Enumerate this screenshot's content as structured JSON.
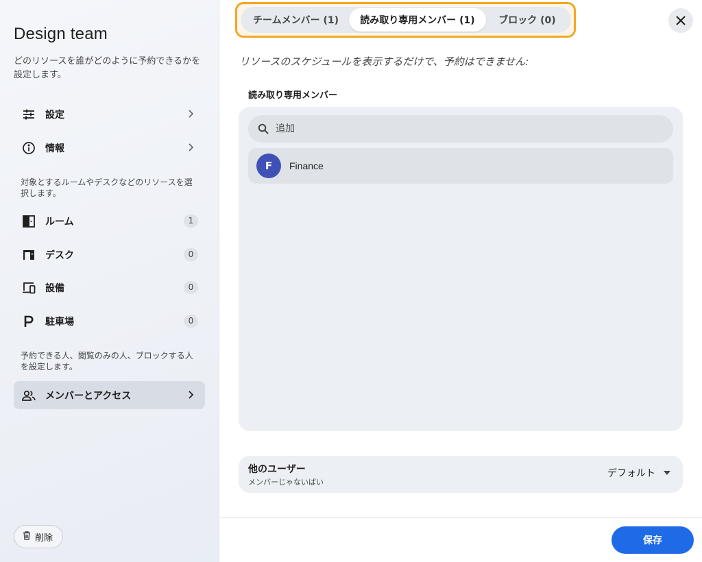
{
  "sidebar": {
    "title": "Design team",
    "description": "どのリソースを誰がどのように予約できるかを設定します。",
    "items_top": [
      {
        "id": "settings",
        "label": "設定",
        "icon": "tune-icon"
      },
      {
        "id": "info",
        "label": "情報",
        "icon": "info-icon"
      }
    ],
    "resources_note": "対象とするルームやデスクなどのリソースを選択します。",
    "resources": [
      {
        "id": "rooms",
        "label": "ルーム",
        "count": "1",
        "icon": "door-icon"
      },
      {
        "id": "desks",
        "label": "デスク",
        "count": "0",
        "icon": "desk-icon"
      },
      {
        "id": "equipment",
        "label": "設備",
        "count": "0",
        "icon": "devices-icon"
      },
      {
        "id": "parking",
        "label": "駐車場",
        "count": "0",
        "icon": "parking-icon"
      }
    ],
    "access_note": "予約できる人、閲覧のみの人、ブロックする人を設定します。",
    "access_item": {
      "label": "メンバーとアクセス",
      "icon": "people-icon"
    },
    "delete_label": "削除"
  },
  "tabs": [
    {
      "label": "チームメンバー (1)",
      "active": false
    },
    {
      "label": "読み取り専用メンバー (1)",
      "active": true
    },
    {
      "label": "ブロック (0)",
      "active": false
    }
  ],
  "main": {
    "subtitle": "リソースのスケジュールを表示するだけで、予約はできません:",
    "section_label": "読み取り専用メンバー",
    "search_placeholder": "追加",
    "members": [
      {
        "initial": "F",
        "name": "Finance",
        "avatar_color": "#3f51b5"
      }
    ],
    "others": {
      "title": "他のユーザー",
      "subtitle": "メンバーじゃないばい",
      "value": "デフォルト"
    },
    "save_label": "保存"
  },
  "colors": {
    "accent": "#1f6ae6",
    "tab_highlight": "#f5a623",
    "avatar": "#3f51b5"
  }
}
